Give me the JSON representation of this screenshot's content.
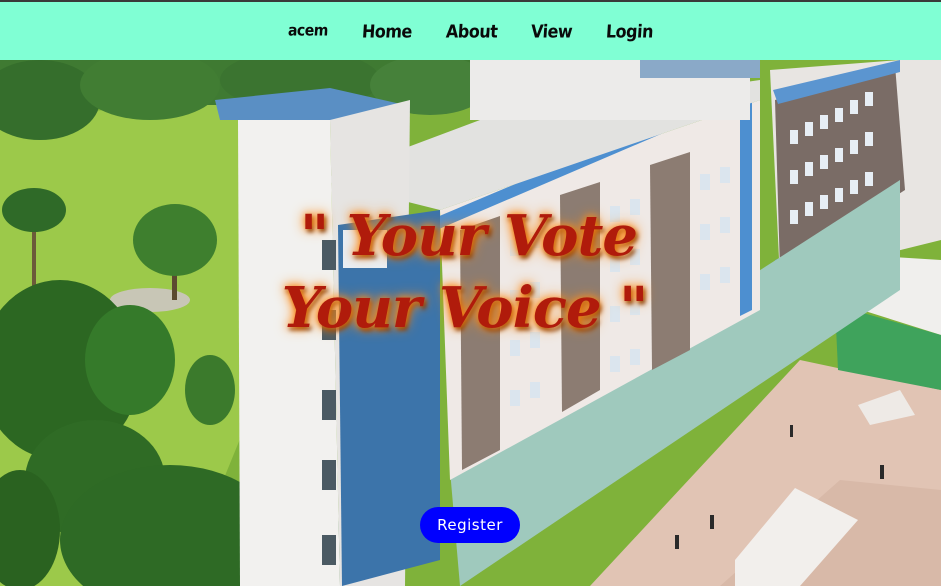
{
  "nav": {
    "brand": "acem",
    "items": [
      {
        "label": "Home"
      },
      {
        "label": "About"
      },
      {
        "label": "View"
      },
      {
        "label": "Login"
      }
    ]
  },
  "hero": {
    "tagline_line1": "\" Your Vote",
    "tagline_line2": "Your Voice \"",
    "register_label": "Register"
  },
  "colors": {
    "nav_bg": "#80ffd4",
    "tagline": "#b01b0b",
    "tagline_glow": "#ff8c1a",
    "button": "#0000ff"
  }
}
